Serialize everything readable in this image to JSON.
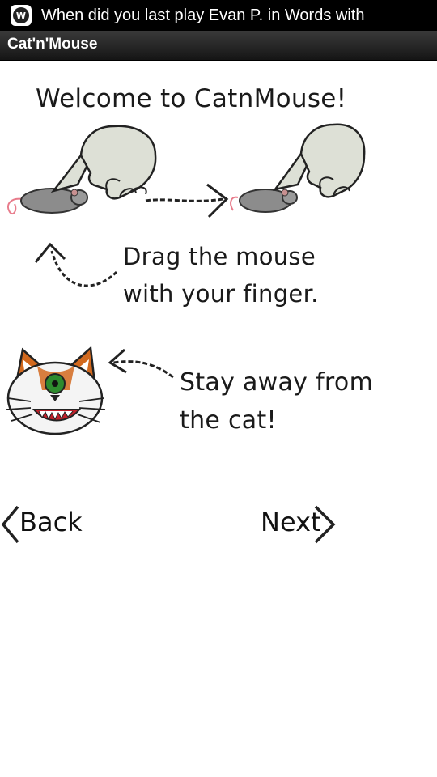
{
  "status_bar": {
    "notification_icon": "words-with-friends-icon",
    "icon_letter": "W",
    "message": "When did you last play Evan P. in Words with"
  },
  "app": {
    "title": "Cat'n'Mouse"
  },
  "tutorial": {
    "welcome": "Welcome to CatnMouse!",
    "drag_line1": "Drag the mouse",
    "drag_line2": "with your finger.",
    "cat_line1": "Stay away from",
    "cat_line2": "the cat!"
  },
  "nav": {
    "back_label": "Back",
    "next_label": "Next"
  },
  "colors": {
    "status_bar": "#000000",
    "title_bar": "#222222",
    "background": "#ffffff",
    "ink": "#1a1a1a",
    "cat_orange": "#d2691e",
    "cat_eye": "#2e8b2e",
    "mouse_tail": "#e87b8b"
  }
}
